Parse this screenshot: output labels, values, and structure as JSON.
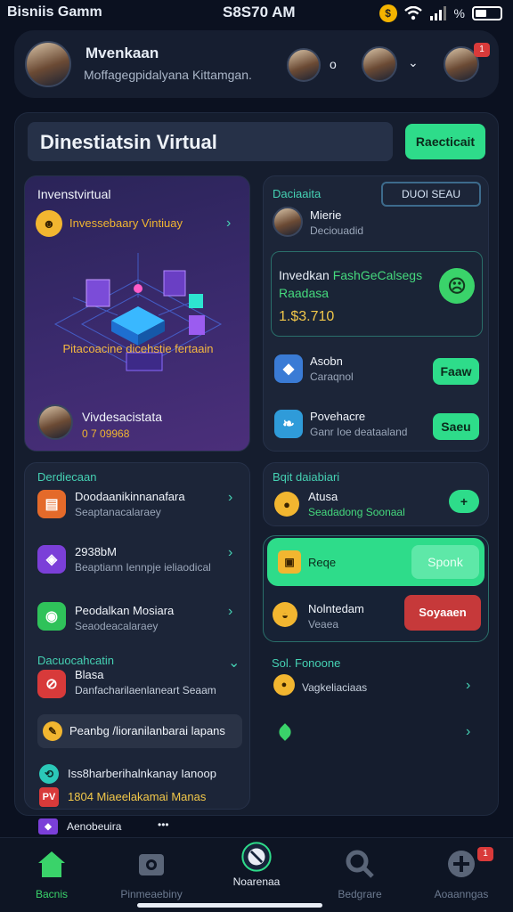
{
  "status": {
    "app": "Bisniis Gamm",
    "time": "S8S70 AM",
    "battery_label": "%"
  },
  "header": {
    "name": "Mvenkaan",
    "subtitle": "Moffagegpidalyana Kittamgan.",
    "mid_symbol": "o",
    "notif_count": "1"
  },
  "main": {
    "search_text": "Dinestiatsin Virtual",
    "top_button": "Raecticait"
  },
  "left_card": {
    "title": "Invenstvirtual",
    "promo_text": "Invessebaary Vintiuay",
    "banner_text": "Pitacoacine dicehstie fertaain",
    "user_name": "Vivdesacistata",
    "user_value": "0 7 09968"
  },
  "right_card": {
    "header_label": "Daciaaita",
    "header_button": "DUOI SEAU",
    "user_name": "Mierie",
    "user_sub": "Deciouadid",
    "invest_title_a": "Invedkan ",
    "invest_title_b": "FashGeCalsegs",
    "invest_title_c": "Raadasa",
    "invest_value": "1.$3.710",
    "row1_title": "Asobn",
    "row1_sub": "Caraqnol",
    "row1_button": "Faaw",
    "row2_title": "Povehacre",
    "row2_sub": "Ganr Ioe deataaland",
    "row2_button": "Saeu"
  },
  "list_left": {
    "header": "Derdiecaan",
    "items": [
      {
        "title": "Doodaanikinnanafara",
        "sub": "Seaptanacalaraey"
      },
      {
        "title": "2938bM",
        "sub": "Beaptiann Iennpje ieliaodical"
      },
      {
        "title": "Peodalkan Mosiara",
        "sub": "Seaodeacalaraey"
      }
    ],
    "section2_header": "Dacuocahcatin",
    "section2_item_title": "Blasa",
    "section2_item_sub": "Danfacharilaenlaneart Seaam",
    "highlight_text": "Peanbg /lioranilanbarai lapans",
    "line1": "Iss8harberihalnkanay Ianoop",
    "line2": "1804 Miaeelakamai Manas",
    "line3": "Aenobeuira",
    "line3_dots": "•••"
  },
  "right_list": {
    "header": "Bqit daiabiari",
    "item_title": "Atusa",
    "item_sub": "Seadadong Soonaal",
    "item_btn": "+",
    "promo_title": "Reqe",
    "promo_button": "Sponk",
    "notice_title": "Nolntedam",
    "notice_sub": "Veaea",
    "notice_button": "Soyaaen",
    "section_header": "Sol. Fonoone",
    "section_item": "Vagkeliaciaas"
  },
  "nav": {
    "items": [
      "Bacnis",
      "Pinmeaebiny",
      "Noarenaa",
      "Bedgrare",
      "Aoaanngas"
    ],
    "badge": "1"
  },
  "colors": {
    "accent_green": "#2edc8a",
    "accent_teal": "#45d1b3",
    "danger": "#c6393a",
    "panel": "#1c2538",
    "bg": "#0b1120"
  },
  "icons": [
    "coin-icon",
    "wifi-icon",
    "signal-icon",
    "battery-icon",
    "chevron-right-icon",
    "chevron-down-icon",
    "home-icon",
    "camera-icon",
    "block-icon",
    "search-icon",
    "add-icon"
  ]
}
